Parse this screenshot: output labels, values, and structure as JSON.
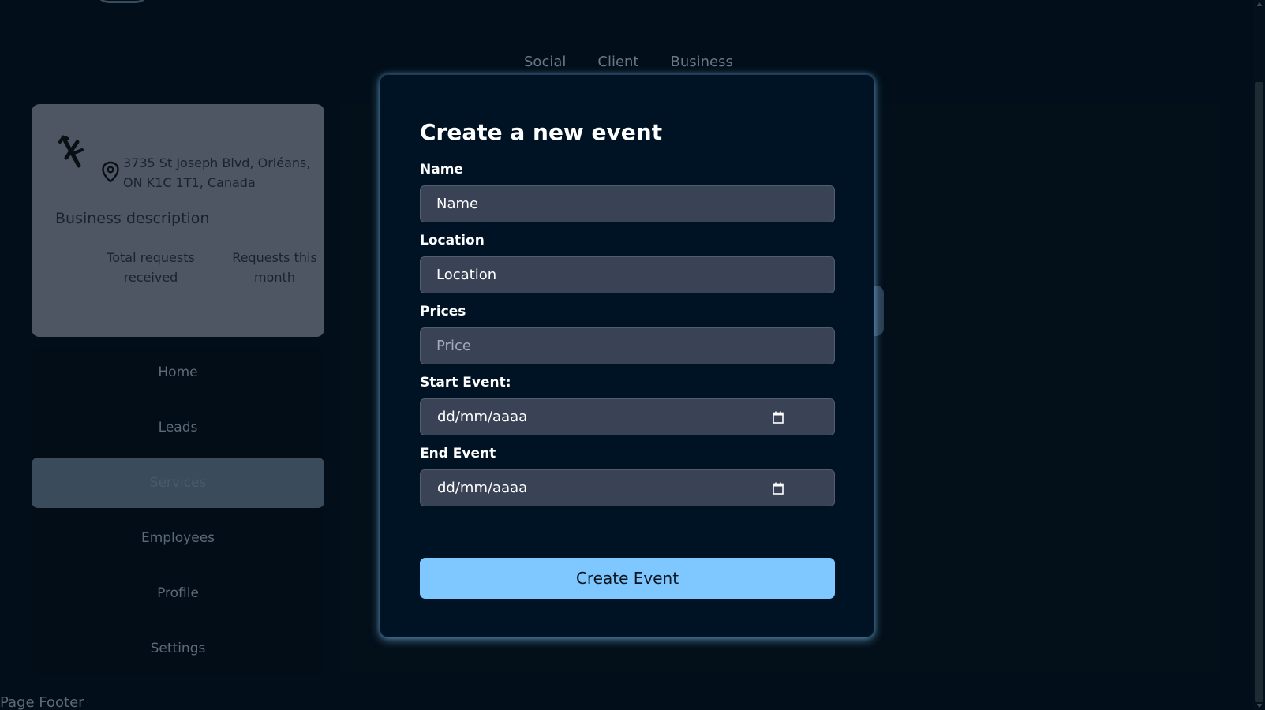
{
  "topnav": {
    "items": [
      "Social",
      "Client",
      "Business"
    ]
  },
  "business": {
    "address": "3735 St Joseph Blvd, Orléans, ON K1C 1T1, Canada",
    "description": "Business description",
    "stats": {
      "total_requests_label": "Total requests received",
      "month_requests_label": "Requests this month"
    }
  },
  "sidebar": {
    "items": [
      "Home",
      "Leads",
      "Services",
      "Employees",
      "Profile",
      "Settings"
    ],
    "active": "Services"
  },
  "footer": {
    "text": "Page Footer"
  },
  "modal": {
    "title": "Create a new event",
    "name_label": "Name",
    "name_placeholder": "Name",
    "location_label": "Location",
    "location_placeholder": "Location",
    "prices_label": "Prices",
    "prices_placeholder": "Price",
    "start_label": "Start Event:",
    "start_value": "dd/mm/aaaa",
    "end_label": "End Event",
    "end_value": "dd/mm/aaaa",
    "submit_label": "Create Event"
  },
  "colors": {
    "accent": "#7ec8ff",
    "background": "#020f1a",
    "modal_bg": "#001325",
    "input_bg": "#3a4355"
  }
}
